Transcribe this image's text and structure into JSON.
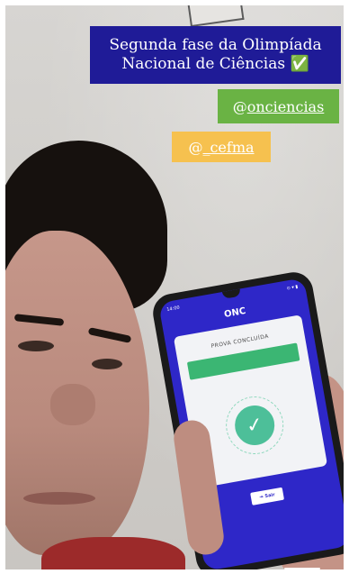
{
  "story": {
    "title_line1": "Segunda fase da Olimpíada",
    "title_line2": "Nacional de Ciências ✅",
    "tag_onc_prefix": "@",
    "tag_onc_handle": "onciencias",
    "tag_cefma_prefix": "@",
    "tag_cefma_handle": "_cefma",
    "colors": {
      "title_bg": "#1f1b97",
      "onc_bg": "#6ab344",
      "cefma_bg": "#f6c14f"
    }
  },
  "phone": {
    "status_time": "14:00",
    "status_right": "⊙ ▾ ▮",
    "app_logo": "ONC",
    "card_title": "PROVA CONCLUÍDA",
    "exit_label": "Sair",
    "icons": [
      "check-icon",
      "exit-icon"
    ],
    "colors": {
      "screen_bg": "#2e27c8",
      "alert_bg": "#3bb673",
      "check_bg": "#4dbf99"
    }
  }
}
